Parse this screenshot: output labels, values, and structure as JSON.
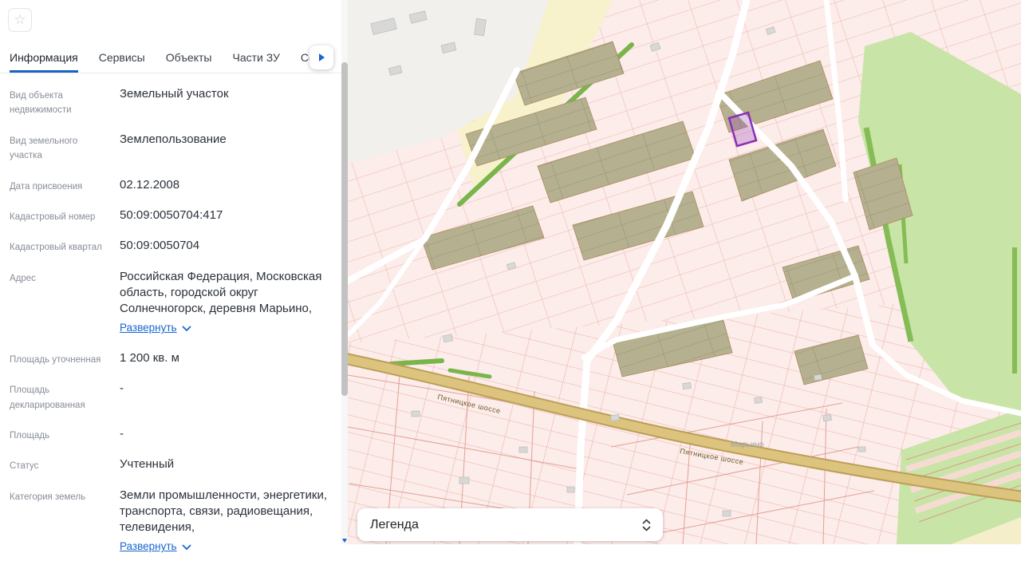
{
  "panel": {
    "favorite_icon": "star",
    "tabs": [
      {
        "label": "Информация",
        "active": true
      },
      {
        "label": "Сервисы",
        "active": false
      },
      {
        "label": "Объекты",
        "active": false
      },
      {
        "label": "Части ЗУ",
        "active": false
      },
      {
        "label": "Соста",
        "active": false
      }
    ],
    "tabs_scroll_icon": "chevron-right",
    "fields": [
      {
        "label": "Вид объекта недвижимости",
        "value": "Земельный участок"
      },
      {
        "label": "Вид земельного участка",
        "value": "Землепользование"
      },
      {
        "label": "Дата присвоения",
        "value": "02.12.2008"
      },
      {
        "label": "Кадастровый номер",
        "value": "50:09:0050704:417"
      },
      {
        "label": "Кадастровый квартал",
        "value": "50:09:0050704"
      },
      {
        "label": "Адрес",
        "value": "Российская Федерация, Московская область, городской округ Солнечногорск, деревня Марьино,",
        "expand_label": "Развернуть"
      },
      {
        "label": "Площадь уточненная",
        "value": "1 200 кв. м"
      },
      {
        "label": "Площадь декларированная",
        "value": "-"
      },
      {
        "label": "Площадь",
        "value": "-"
      },
      {
        "label": "Статус",
        "value": "Учтенный"
      },
      {
        "label": "Категория земель",
        "value": "Земли промышленности, энергетики, транспорта, связи, радиовещания, телевидения,",
        "expand_label": "Развернуть"
      }
    ]
  },
  "map": {
    "legend": {
      "label": "Легенда",
      "icon": "sort-arrows"
    },
    "road_labels": [
      "Пятницкое шоссе",
      "Пятницкое шоссе"
    ],
    "place_labels": [
      "Марьино"
    ],
    "colors": {
      "parcel_pink": "#fcecea",
      "parcel_line": "#ecb2a6",
      "parcel_tan": "#b5b08f",
      "greenery": "#c8e4a6",
      "highway": "#dcc47e",
      "highlight_parcel": "#8a2fb8",
      "accent_blue": "#1766d1"
    }
  }
}
